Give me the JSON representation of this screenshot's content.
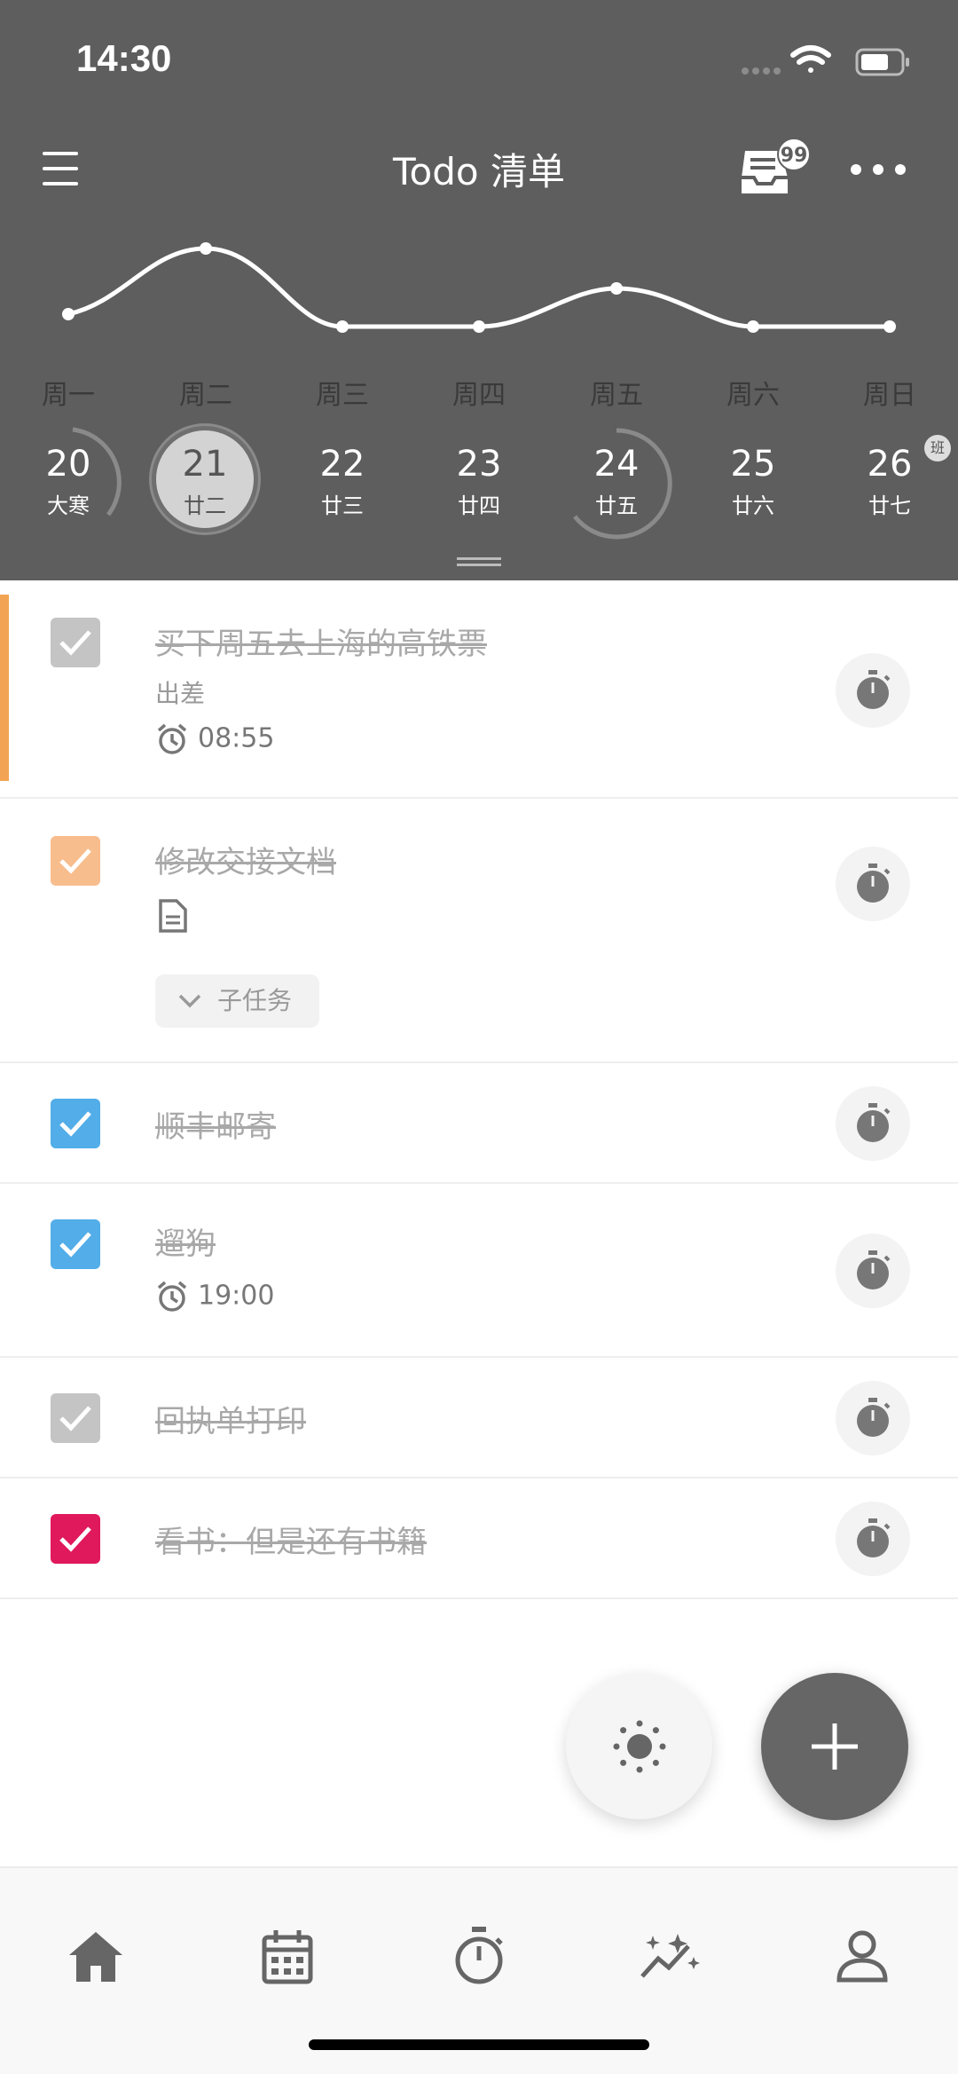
{
  "status": {
    "time": "14:30"
  },
  "header": {
    "title": "Todo 清单",
    "inbox_badge": "99",
    "icons": [
      "menu-icon",
      "inbox-icon",
      "more-icon"
    ]
  },
  "week": {
    "weekdays": [
      "周一",
      "周二",
      "周三",
      "周四",
      "周五",
      "周六",
      "周日"
    ],
    "days": [
      {
        "num": "20",
        "lunar": "大寒"
      },
      {
        "num": "21",
        "lunar": "廿二"
      },
      {
        "num": "22",
        "lunar": "廿三"
      },
      {
        "num": "23",
        "lunar": "廿四"
      },
      {
        "num": "24",
        "lunar": "廿五"
      },
      {
        "num": "25",
        "lunar": "廿六"
      },
      {
        "num": "26",
        "lunar": "廿七"
      }
    ],
    "selected_day": "21",
    "workday_badge": "班"
  },
  "tasks": [
    {
      "title": "买下周五去上海的高铁票",
      "subtitle": "出差",
      "alarm": "08:55",
      "check_color": "#c4c4c4"
    },
    {
      "title": "修改交接文档",
      "subtask_label": "子任务",
      "check_color": "#f8bd8d"
    },
    {
      "title": "顺丰邮寄",
      "check_color": "#52ade8"
    },
    {
      "title": "遛狗",
      "alarm": "19:00",
      "check_color": "#52ade8"
    },
    {
      "title": "回执单打印",
      "check_color": "#c4c4c4"
    },
    {
      "title": "看书：但是还有书籍",
      "check_color": "#e0185c"
    }
  ],
  "fab": {
    "sun_icon": "brightness-icon",
    "add_icon": "plus-icon"
  },
  "tabbar": {
    "icons": [
      "home-icon",
      "calendar-icon",
      "stopwatch-icon",
      "stats-icon",
      "profile-icon"
    ]
  },
  "colors": {
    "header_bg": "#5e5e5e",
    "accent_orange": "#f2a454",
    "blue": "#52ade8",
    "red": "#e0185c"
  }
}
